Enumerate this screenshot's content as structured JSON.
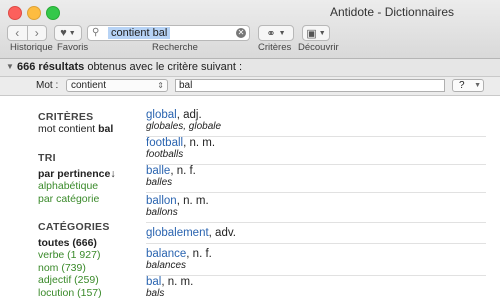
{
  "window": {
    "title": "Antidote - Dictionnaires"
  },
  "toolbar": {
    "history_label": "Historique",
    "favorites_label": "Favoris",
    "search_label": "Recherche",
    "criteria_label": "Critères",
    "discover_label": "Découvrir",
    "search_value": "contient bal"
  },
  "results_header": {
    "count": "666 résultats",
    "text": " obtenus avec le critère suivant :"
  },
  "criteria_row": {
    "label": "Mot :",
    "mode": "contient",
    "value": "bal",
    "help": "?"
  },
  "criteria": {
    "title": "CRITÈRES",
    "line_prefix": "mot contient ",
    "line_word": "bal"
  },
  "sort": {
    "title": "TRI",
    "items": [
      "par pertinence↓",
      "alphabétique",
      "par catégorie"
    ]
  },
  "categories": {
    "title": "CATÉGORIES",
    "items": [
      "toutes (666)",
      "verbe (1 927)",
      "nom (739)",
      "adjectif (259)",
      "locution (157)"
    ]
  },
  "results": [
    {
      "word": "global",
      "gram": ", adj.",
      "forms": "globales, globale"
    },
    {
      "word": "football",
      "gram": ", n. m.",
      "forms": "footballs"
    },
    {
      "word": "balle",
      "gram": ", n. f.",
      "forms": "balles"
    },
    {
      "word": "ballon",
      "gram": ", n. m.",
      "forms": "ballons"
    },
    {
      "word": "globalement",
      "gram": ", adv.",
      "forms": ""
    },
    {
      "word": "balance",
      "gram": ", n. f.",
      "forms": "balances"
    },
    {
      "word": "bal",
      "gram": ", n. m.",
      "forms": "bals"
    }
  ],
  "colors": {
    "link": "#2a64b0",
    "green": "#3a8a2a"
  }
}
